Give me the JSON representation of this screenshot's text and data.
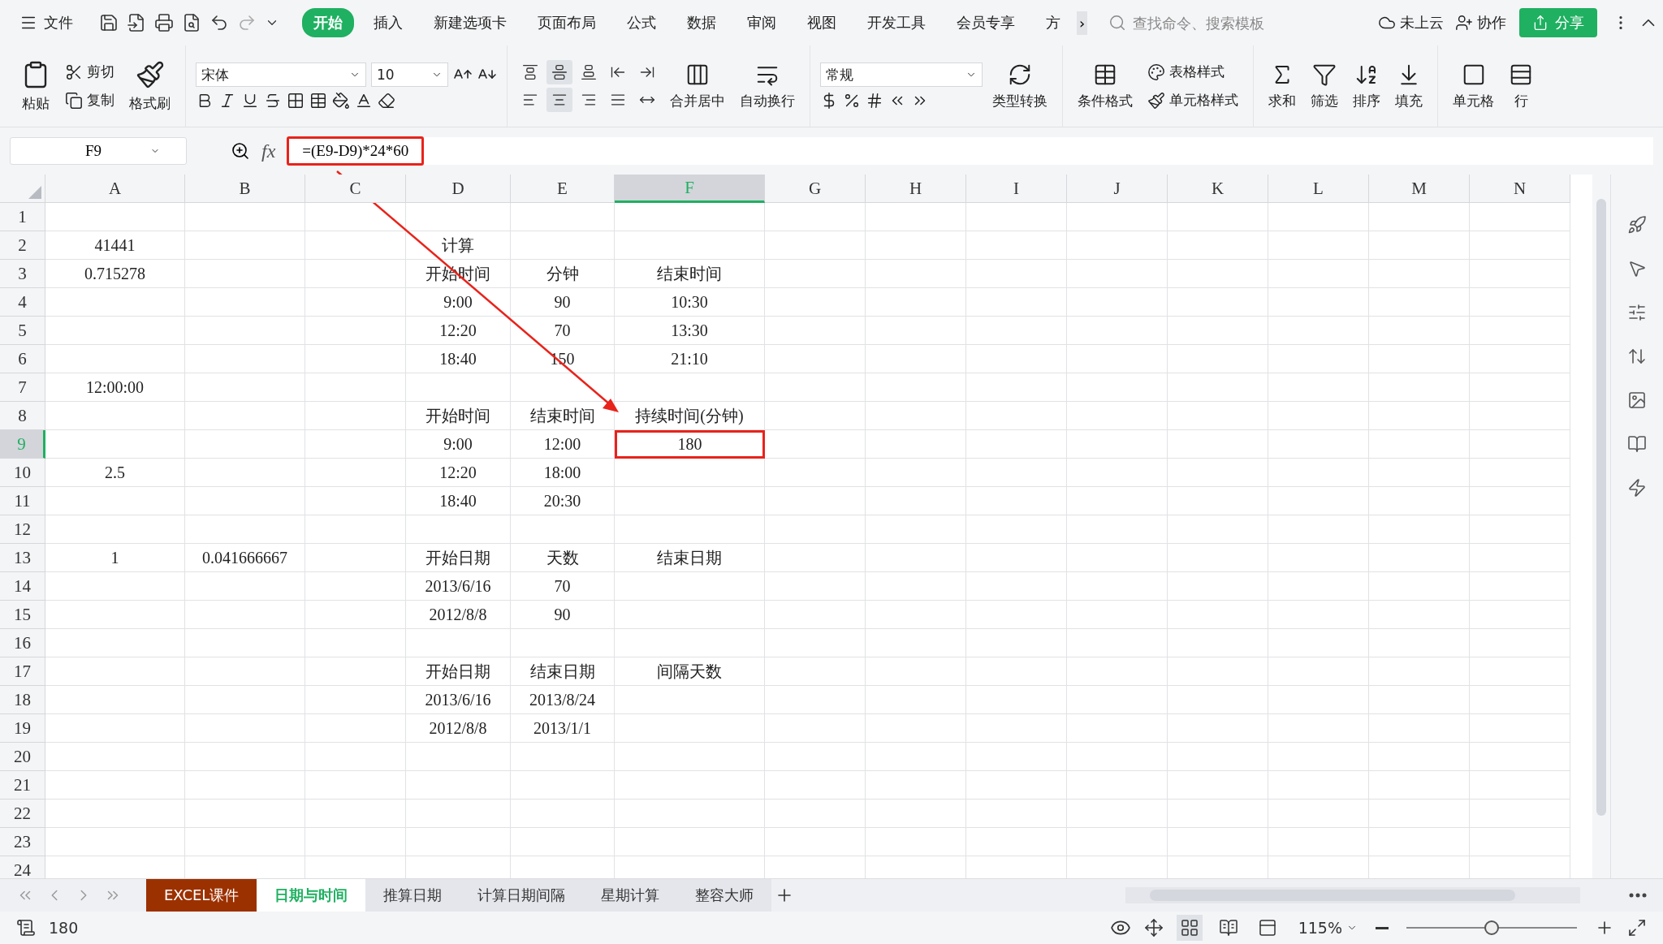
{
  "menu": {
    "file": "文件",
    "tabs": [
      {
        "label": "开始",
        "selected": true
      },
      {
        "label": "插入",
        "selected": false
      },
      {
        "label": "新建选项卡",
        "selected": false
      },
      {
        "label": "页面布局",
        "selected": false
      },
      {
        "label": "公式",
        "selected": false
      },
      {
        "label": "数据",
        "selected": false
      },
      {
        "label": "审阅",
        "selected": false
      },
      {
        "label": "视图",
        "selected": false
      },
      {
        "label": "开发工具",
        "selected": false
      },
      {
        "label": "会员专享",
        "selected": false
      },
      {
        "label": "方",
        "selected": false
      }
    ],
    "more": "›",
    "search": {
      "placeholder": "查找命令、搜索模板"
    },
    "cloud": "未上云",
    "collab": "协作",
    "share": "分享"
  },
  "ribbon": {
    "paste": "粘贴",
    "cut": "剪切",
    "copy": "复制",
    "format_painter": "格式刷",
    "font": "宋体",
    "font_size": "10",
    "align_buttons": [
      {
        "kind": "top",
        "selected": false
      },
      {
        "kind": "middle",
        "selected": true
      },
      {
        "kind": "bottom",
        "selected": false
      },
      {
        "kind": "outdent",
        "selected": false
      },
      {
        "kind": "indent",
        "selected": false
      },
      {
        "kind": "left",
        "selected": false
      },
      {
        "kind": "center",
        "selected": true
      },
      {
        "kind": "right",
        "selected": false
      },
      {
        "kind": "justify",
        "selected": false
      },
      {
        "kind": "distribute",
        "selected": false
      }
    ],
    "merge": "合并居中",
    "wrap": "自动换行",
    "number_format": "常规",
    "type_convert": "类型转换",
    "conditional_format": "条件格式",
    "table_style": "表格样式",
    "cell_style": "单元格样式",
    "sum": "求和",
    "filter": "筛选",
    "sort": "排序",
    "fill": "填充",
    "cell": "单元格",
    "row_col": "行"
  },
  "formula_bar": {
    "name_box": "F9",
    "fx": "fx",
    "formula": "=(E9-D9)*24*60"
  },
  "sheet": {
    "columns": [
      {
        "label": "A",
        "selected": false
      },
      {
        "label": "B",
        "selected": false
      },
      {
        "label": "C",
        "selected": false
      },
      {
        "label": "D",
        "selected": false
      },
      {
        "label": "E",
        "selected": false
      },
      {
        "label": "F",
        "selected": true
      },
      {
        "label": "G",
        "selected": false
      },
      {
        "label": "H",
        "selected": false
      },
      {
        "label": "I",
        "selected": false
      },
      {
        "label": "J",
        "selected": false
      },
      {
        "label": "K",
        "selected": false
      },
      {
        "label": "L",
        "selected": false
      },
      {
        "label": "M",
        "selected": false
      },
      {
        "label": "N",
        "selected": false
      }
    ],
    "rows": [
      {
        "number": "1",
        "selected": false
      },
      {
        "number": "2",
        "selected": false,
        "cells": {
          "A": "41441",
          "D": "计算"
        }
      },
      {
        "number": "3",
        "selected": false,
        "cells": {
          "A": "0.715278",
          "D": "开始时间",
          "E": "分钟",
          "F": "结束时间"
        }
      },
      {
        "number": "4",
        "selected": false,
        "cells": {
          "D": "9:00",
          "E": "90",
          "F": "10:30"
        }
      },
      {
        "number": "5",
        "selected": false,
        "cells": {
          "D": "12:20",
          "E": "70",
          "F": "13:30"
        }
      },
      {
        "number": "6",
        "selected": false,
        "cells": {
          "D": "18:40",
          "E": "150",
          "F": "21:10"
        }
      },
      {
        "number": "7",
        "selected": false,
        "cells": {
          "A": "12:00:00"
        }
      },
      {
        "number": "8",
        "selected": false,
        "cells": {
          "D": "开始时间",
          "E": "结束时间",
          "F": "持续时间(分钟)"
        }
      },
      {
        "number": "9",
        "selected": true,
        "cells": {
          "D": "9:00",
          "E": "12:00",
          "F": "180"
        }
      },
      {
        "number": "10",
        "selected": false,
        "cells": {
          "A": "2.5",
          "D": "12:20",
          "E": "18:00"
        }
      },
      {
        "number": "11",
        "selected": false,
        "cells": {
          "D": "18:40",
          "E": "20:30"
        }
      },
      {
        "number": "12",
        "selected": false
      },
      {
        "number": "13",
        "selected": false,
        "cells": {
          "A": "1",
          "B": "0.041666667",
          "D": "开始日期",
          "E": "天数",
          "F": "结束日期"
        }
      },
      {
        "number": "14",
        "selected": false,
        "cells": {
          "D": "2013/6/16",
          "E": "70"
        }
      },
      {
        "number": "15",
        "selected": false,
        "cells": {
          "D": "2012/8/8",
          "E": "90"
        }
      },
      {
        "number": "16",
        "selected": false
      },
      {
        "number": "17",
        "selected": false,
        "cells": {
          "D": "开始日期",
          "E": "结束日期",
          "F": "间隔天数"
        }
      },
      {
        "number": "18",
        "selected": false,
        "cells": {
          "D": "2013/6/16",
          "E": "2013/8/24"
        }
      },
      {
        "number": "19",
        "selected": false,
        "cells": {
          "D": "2012/8/8",
          "E": "2013/1/1"
        }
      },
      {
        "number": "20",
        "selected": false
      },
      {
        "number": "21",
        "selected": false
      },
      {
        "number": "22",
        "selected": false
      },
      {
        "number": "23",
        "selected": false
      },
      {
        "number": "24",
        "selected": false
      }
    ]
  },
  "sheet_tabs": [
    {
      "label": "EXCEL课件",
      "selected": false,
      "color": "#9c3100"
    },
    {
      "label": "日期与时间",
      "selected": true
    },
    {
      "label": "推算日期",
      "selected": false
    },
    {
      "label": "计算日期间隔",
      "selected": false
    },
    {
      "label": "星期计算",
      "selected": false
    },
    {
      "label": "整容大师",
      "selected": false
    }
  ],
  "status_bar": {
    "value": "180",
    "zoom": "115%",
    "zoom_slider": {
      "level": 0.5
    },
    "views": [
      {
        "kind": "normal",
        "selected": true
      },
      {
        "kind": "reading",
        "selected": false
      },
      {
        "kind": "page",
        "selected": false
      }
    ]
  }
}
